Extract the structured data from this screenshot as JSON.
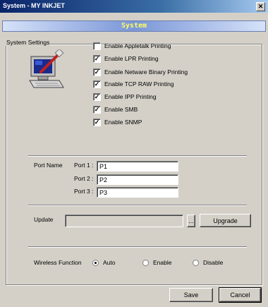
{
  "window": {
    "title": "System - MY INKJET",
    "close_glyph": "✕"
  },
  "banner": {
    "text": "System"
  },
  "settings": {
    "group_label": "System Settings",
    "options": [
      {
        "label": "Enable Appletalk Printing",
        "checked": false
      },
      {
        "label": "Enable LPR Printing",
        "checked": true
      },
      {
        "label": "Enable Netware Binary Printing",
        "checked": true
      },
      {
        "label": "Enable TCP RAW Printing",
        "checked": true
      },
      {
        "label": "Enable IPP Printing",
        "checked": true
      },
      {
        "label": "Enable SMB",
        "checked": true
      },
      {
        "label": "Enable SNMP",
        "checked": true
      }
    ]
  },
  "ports": {
    "label": "Port Name",
    "items": [
      {
        "label": "Port 1 :",
        "value": "P1"
      },
      {
        "label": "Port 2 :",
        "value": "P2"
      },
      {
        "label": "Port 3 :",
        "value": "P3"
      }
    ]
  },
  "update": {
    "label": "Update",
    "path_value": "",
    "browse_label": "...",
    "upgrade_label": "Upgrade"
  },
  "wireless": {
    "label": "Wireless Function",
    "options": [
      {
        "label": "Auto",
        "selected": true
      },
      {
        "label": "Enable",
        "selected": false
      },
      {
        "label": "Disable",
        "selected": false
      }
    ]
  },
  "footer": {
    "save_label": "Save",
    "cancel_label": "Cancel"
  },
  "icon": {
    "name": "computer-settings-icon"
  }
}
